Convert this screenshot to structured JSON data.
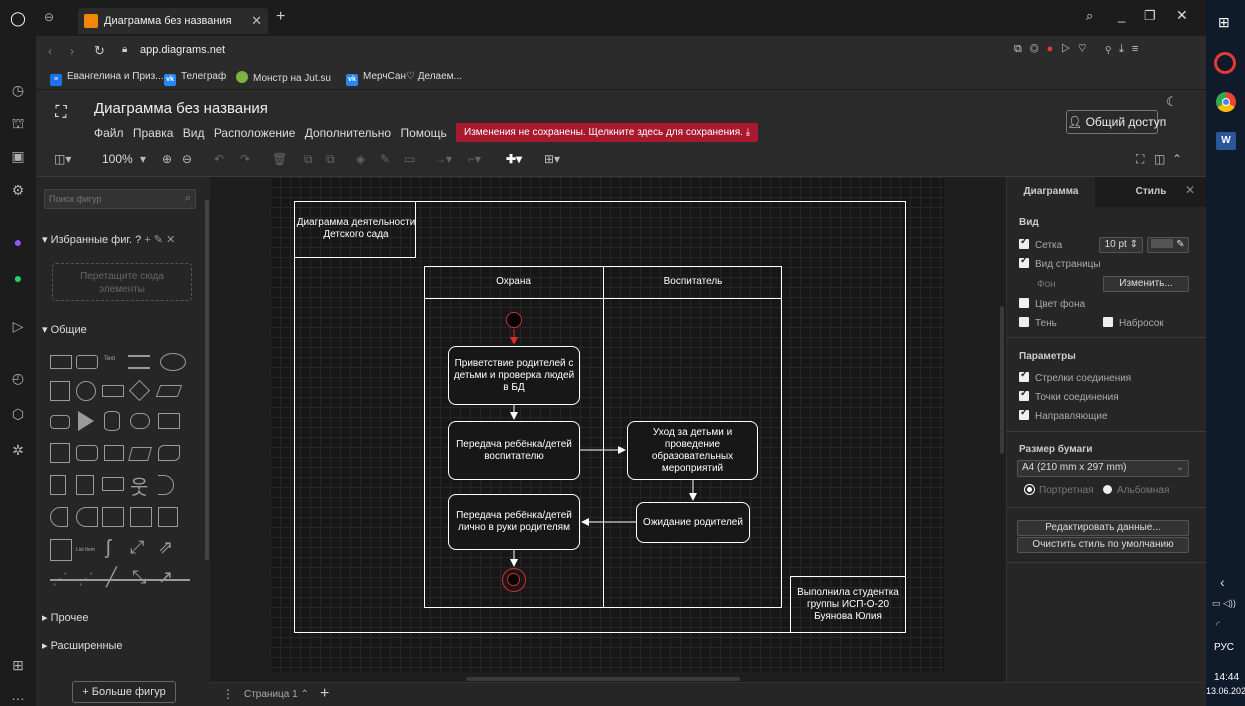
{
  "browser": {
    "tab_title": "Диаграмма без названия",
    "url": "app.diagrams.net",
    "new_tab": "+",
    "bookmarks": [
      {
        "label": "Евангелина и Приз...",
        "icon": "doc-icon",
        "color": "#1a73e8"
      },
      {
        "label": "Телеграф",
        "icon": "vk-icon",
        "color": "#2787f5"
      },
      {
        "label": "Монстр на Jut.su",
        "icon": "jutsu-icon",
        "color": "#7cb342"
      },
      {
        "label": "МерчСан♡ Делаем...",
        "icon": "vk-icon",
        "color": "#2787f5"
      }
    ]
  },
  "app": {
    "title": "Диаграмма без названия",
    "menu": [
      "Файл",
      "Правка",
      "Вид",
      "Расположение",
      "Дополнительно",
      "Помощь"
    ],
    "unsaved_banner": "Изменения не сохранены. Щелкните здесь для сохранения.",
    "share_button": "Общий доступ",
    "zoom": "100%",
    "accent": "#f08705",
    "banner_color": "#a8192e"
  },
  "left_panel": {
    "search_placeholder": "Поиск фигур",
    "favorites_title": "Избранные фиг. ?",
    "favorites_drop": "Перетащите сюда элементы",
    "general_title": "Общие",
    "other_title": "Прочее",
    "advanced_title": "Расширенные",
    "more_shapes": "+ Больше фигур"
  },
  "diagram": {
    "title": "Диаграмма деятельности Детского сада",
    "lane1": "Охрана",
    "lane2": "Воспитатель",
    "node1": "Приветствие родителей с детьми и проверка людей в БД",
    "node2": "Передача ребёнка/детей воспитателю",
    "node3": "Уход за детьми и проведение образовательных мероприятий",
    "node4": "Ожидание родителей",
    "node5": "Передача ребёнка/детей лично в руки родителям",
    "author": "Выполнила студентка группы ИСП-О-20 Буянова Юлия"
  },
  "right_panel": {
    "tab_diagram": "Диаграмма",
    "tab_style": "Стиль",
    "view_title": "Вид",
    "grid": "Сетка",
    "grid_size": "10 pt",
    "page_view": "Вид страницы",
    "background": "Фон",
    "change_button": "Изменить...",
    "background_color": "Цвет фона",
    "shadow": "Тень",
    "sketch": "Набросок",
    "options_title": "Параметры",
    "connection_arrows": "Стрелки соединения",
    "connection_points": "Точки соединения",
    "guides": "Направляющие",
    "paper_title": "Размер бумаги",
    "paper_size": "A4 (210 mm x 297 mm)",
    "portrait": "Портретная",
    "landscape": "Альбомная",
    "edit_data": "Редактировать данные...",
    "clear_style": "Очистить стиль по умолчанию"
  },
  "bottom": {
    "page_tab": "Страница 1"
  },
  "taskbar": {
    "lang": "РУС",
    "time": "14:44",
    "date": "13.06.202"
  }
}
